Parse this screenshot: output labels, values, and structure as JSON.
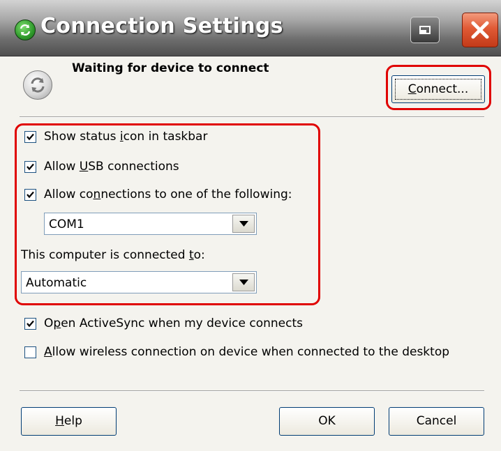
{
  "window": {
    "title": "Connection Settings",
    "app_icon": "activesync-icon",
    "restore_icon": "restore-icon",
    "close_icon": "close-icon"
  },
  "status": {
    "icon": "sync-icon",
    "text": "Waiting for device to connect",
    "connect_button": {
      "mnemonic": "C",
      "rest": "onnect..."
    }
  },
  "options": {
    "show_status_icon": {
      "checked": true,
      "pre": "Show status ",
      "mn": "i",
      "post": "con in taskbar"
    },
    "allow_usb": {
      "checked": true,
      "pre": "Allow ",
      "mn": "U",
      "post": "SB connections"
    },
    "allow_connections": {
      "checked": true,
      "pre": "Allow co",
      "mn": "n",
      "post": "nections to one of the following:"
    },
    "port_select": {
      "value": "COM1"
    },
    "connected_to_label": {
      "pre": "This computer is connected ",
      "mn": "t",
      "post": "o:"
    },
    "connected_to_select": {
      "value": "Automatic"
    },
    "open_activesync": {
      "checked": true,
      "pre": "O",
      "mn": "p",
      "post": "en ActiveSync when my device connects"
    },
    "allow_wireless": {
      "checked": false,
      "pre": "",
      "mn": "A",
      "post": "llow wireless connection on device when connected to the desktop"
    }
  },
  "footer": {
    "help": {
      "mnemonic": "H",
      "rest": "elp"
    },
    "ok": "OK",
    "cancel": "Cancel"
  },
  "colors": {
    "highlight": "#e00000",
    "dialog_bg": "#f4f3ee"
  }
}
